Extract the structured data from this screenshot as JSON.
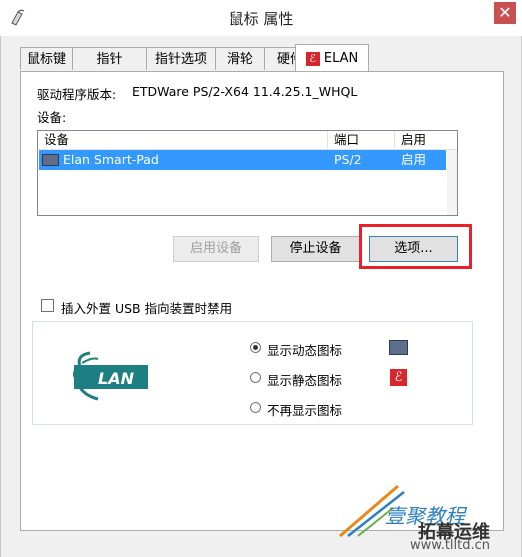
{
  "window": {
    "title": "鼠标 属性",
    "close_label": "✕"
  },
  "tabs": [
    {
      "label": "鼠标键"
    },
    {
      "label": "指针"
    },
    {
      "label": "指针选项"
    },
    {
      "label": "滑轮"
    },
    {
      "label": "硬件"
    },
    {
      "label": "ELAN",
      "active": true
    }
  ],
  "driver": {
    "label": "驱动程序版本:",
    "value": "ETDWare PS/2-X64 11.4.25.1_WHQL"
  },
  "devices_label": "设备:",
  "device_list": {
    "columns": [
      "设备",
      "端口",
      "启用"
    ],
    "rows": [
      {
        "device": "Elan Smart-Pad",
        "port": "PS/2",
        "enabled": "启用",
        "selected": true
      }
    ]
  },
  "buttons": {
    "enable": "启用设备",
    "stop": "停止设备",
    "options": "选项..."
  },
  "usb_checkbox": {
    "label": "插入外置 USB 指向装置时禁用",
    "checked": false
  },
  "logo_text": "LAN",
  "tray_icon_options": [
    {
      "label": "显示动态图标",
      "checked": true,
      "icon": "touchpad-icon"
    },
    {
      "label": "显示静态图标",
      "checked": false,
      "icon": "elan-e-icon"
    },
    {
      "label": "不再显示图标",
      "checked": false
    }
  ],
  "watermark": {
    "line1": "壹聚教程",
    "line2": "拓幕运维",
    "url": "www.tlltd.cn"
  },
  "colors": {
    "selection": "#3399ff",
    "highlight": "#e8212a",
    "elan_teal": "#1e7f82",
    "close_button": "#c75050"
  }
}
